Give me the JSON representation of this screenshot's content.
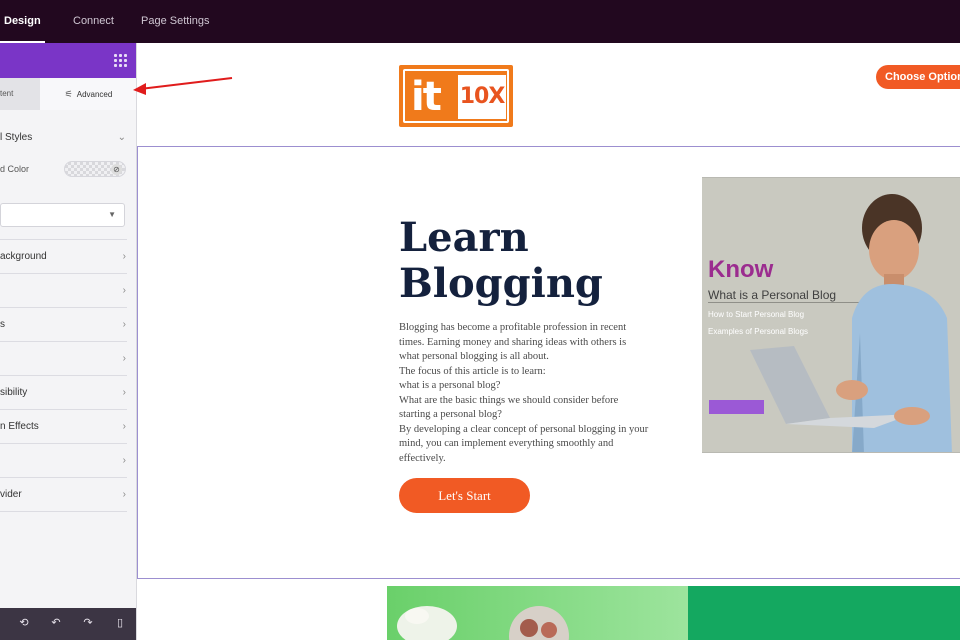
{
  "topbar": {
    "tabs": [
      {
        "label": "Design",
        "active": true
      },
      {
        "label": "Connect",
        "active": false
      },
      {
        "label": "Page Settings",
        "active": false
      }
    ]
  },
  "panel": {
    "subtabs": {
      "content": "tent",
      "advanced": "Advanced"
    },
    "rows": [
      {
        "label": "l Styles",
        "icon": "chevron-down-icon"
      },
      {
        "label": "d Color"
      },
      {
        "label": "ackground",
        "icon": "chevron-right-icon"
      },
      {
        "label": "",
        "icon": "chevron-right-icon"
      },
      {
        "label": "s",
        "icon": "chevron-right-icon"
      },
      {
        "label": "",
        "icon": "chevron-right-icon"
      },
      {
        "label": "sibility",
        "icon": "chevron-right-icon"
      },
      {
        "label": "n Effects",
        "icon": "chevron-right-icon"
      },
      {
        "label": "",
        "icon": "chevron-right-icon"
      },
      {
        "label": "vider",
        "icon": "chevron-right-icon"
      }
    ],
    "accent_color": "#7a35c7",
    "footer_icons": [
      "history-icon",
      "undo-icon",
      "redo-icon",
      "mobile-preview-icon"
    ]
  },
  "canvas": {
    "logo": {
      "part1": "it",
      "part2": "10X"
    },
    "choose_button": "Choose Option",
    "hero": {
      "title_line1": "Learn",
      "title_line2": "Blogging",
      "body_lines": [
        "Blogging has become a profitable profession in recent",
        "times. Earning money and sharing ideas with others is",
        "what personal blogging is all about.",
        "The focus of this article is to learn:",
        "what is a personal blog?",
        "What are the basic things we should consider before",
        "starting a personal blog?",
        "By developing a clear concept of personal blogging in your",
        "mind, you can implement everything smoothly and",
        "effectively."
      ],
      "cta": "Let's Start"
    },
    "card": {
      "heading": "Know",
      "subheading": "What is a Personal Blog",
      "link1": "How to Start Personal Blog",
      "link2": "Examples of Personal Blogs"
    },
    "brand_color": "#f15a24"
  }
}
